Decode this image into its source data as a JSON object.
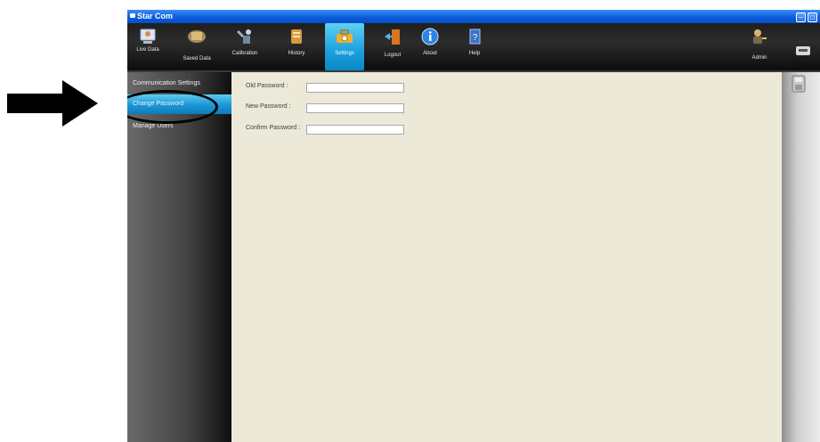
{
  "window": {
    "title": "Star Com"
  },
  "toolbar": {
    "items": [
      {
        "label": "Live Data",
        "icon": "monitor-icon"
      },
      {
        "label": "Saved Data",
        "icon": "hand-folder-icon"
      },
      {
        "label": "Calibration",
        "icon": "calibration-tools-icon"
      },
      {
        "label": "History",
        "icon": "history-scroll-icon"
      },
      {
        "label": "Settings",
        "icon": "toolbox-settings-icon",
        "active": true
      },
      {
        "label": "Logout",
        "icon": "door-exit-icon"
      },
      {
        "label": "About",
        "icon": "info-icon"
      },
      {
        "label": "Help",
        "icon": "help-book-icon"
      },
      {
        "label": "Admin",
        "icon": "user-admin-icon"
      }
    ]
  },
  "sidebar": {
    "items": [
      {
        "label": "Communication Settings"
      },
      {
        "label": "Change Password",
        "active": true
      },
      {
        "label": "Manage Users"
      }
    ]
  },
  "form": {
    "old_password_label": "Old Password :",
    "new_password_label": "New Password :",
    "confirm_password_label": "Confirm Password :",
    "old_password_value": "",
    "new_password_value": "",
    "confirm_password_value": ""
  },
  "colors": {
    "titlebar": "#0a5ad8",
    "active_tab": "#1aa0dd",
    "content_bg": "#ece9d8"
  }
}
